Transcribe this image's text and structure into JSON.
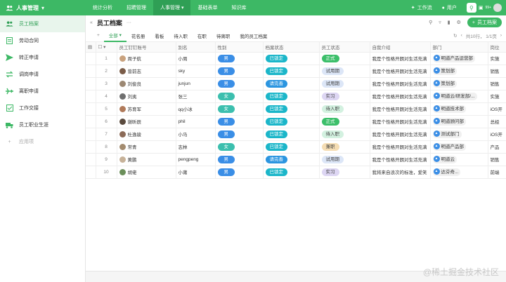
{
  "topbar": {
    "app_title": "人事管理",
    "nav": [
      "统计分析",
      "招聘管理",
      "人事管理",
      "基础表单",
      "知识库"
    ],
    "workflow": "工作流",
    "users": "用户",
    "badge": "99+"
  },
  "sidebar": {
    "items": [
      "员工档案",
      "劳动合同",
      "转正申请",
      "调岗申请",
      "离职申请",
      "工作交接",
      "员工职业生涯"
    ],
    "add_label": "应用项"
  },
  "header": {
    "title": "员工档案",
    "add_button": "员工档案"
  },
  "tabs": [
    "全部",
    "花名册",
    "看板",
    "待入职",
    "在职",
    "待离职",
    "我的员工档案"
  ],
  "pagination": "共10行， 1/1页",
  "table": {
    "columns": [
      "",
      "",
      "员工钉钉账号",
      "别名",
      "性别",
      "档案状态",
      "员工状态",
      "自我介绍",
      "部门",
      "岗位"
    ],
    "rows": [
      {
        "n": "1",
        "name": "周子航",
        "alias": "小周",
        "gender": "男",
        "gclass": "g-m",
        "arch": "已锁定",
        "aclass": "s1",
        "emp": "正式",
        "eclass": "e-zs",
        "intro": "我是个性格开朗对生活充满",
        "dept": "明道产品运营部",
        "pos": "实施"
      },
      {
        "n": "2",
        "name": "曾前志",
        "alias": "sky",
        "gender": "男",
        "gclass": "g-m",
        "arch": "已锁定",
        "aclass": "s1",
        "emp": "试用期",
        "eclass": "e-sy",
        "intro": "我是个性格开朗对生活充满",
        "dept": "策划部",
        "pos": "销售"
      },
      {
        "n": "3",
        "name": "刘俊良",
        "alias": "junjun",
        "gender": "男",
        "gclass": "g-m",
        "arch": "请完善",
        "aclass": "s2",
        "emp": "试用期",
        "eclass": "e-sy",
        "intro": "我是个性格开朗对生活充满",
        "dept": "策划部",
        "pos": "销售"
      },
      {
        "n": "4",
        "name": "刘夷",
        "alias": "张三",
        "gender": "女",
        "gclass": "g-f",
        "arch": "已锁定",
        "aclass": "s1",
        "emp": "实习",
        "eclass": "e-sx",
        "intro": "我是个性格开朗对生活充满",
        "dept": "明道云/研发部/...",
        "pos": "实施"
      },
      {
        "n": "5",
        "name": "苏育军",
        "alias": "qq小冰",
        "gender": "女",
        "gclass": "g-f",
        "arch": "已锁定",
        "aclass": "s1",
        "emp": "待入职",
        "eclass": "e-dr",
        "intro": "我是个性格开朗对生活充满",
        "dept": "明道技术部",
        "pos": "iOS开"
      },
      {
        "n": "6",
        "name": "谢昕辰",
        "alias": "phil",
        "gender": "男",
        "gclass": "g-m",
        "arch": "已锁定",
        "aclass": "s1",
        "emp": "正式",
        "eclass": "e-zs",
        "intro": "我是个性格开朗对生活充满",
        "dept": "明道顾问部",
        "pos": "总经"
      },
      {
        "n": "7",
        "name": "杜逸骏",
        "alias": "小马",
        "gender": "男",
        "gclass": "g-m",
        "arch": "已锁定",
        "aclass": "s1",
        "emp": "待入职",
        "eclass": "e-dr",
        "intro": "我是个性格开朗对生活充满",
        "dept": "测试部门",
        "pos": "iOS开"
      },
      {
        "n": "8",
        "name": "常青",
        "alias": "志林",
        "gender": "女",
        "gclass": "g-f",
        "arch": "已锁定",
        "aclass": "s1",
        "emp": "兼职",
        "eclass": "e-jz",
        "intro": "我是个性格开朗对生活充满",
        "dept": "明道产品部",
        "pos": "产品"
      },
      {
        "n": "9",
        "name": "黄鹏",
        "alias": "pengpeng",
        "gender": "男",
        "gclass": "g-m",
        "arch": "请完善",
        "aclass": "s2",
        "emp": "试用期",
        "eclass": "e-sy",
        "intro": "我是个性格开朗对生活充满",
        "dept": "明道云",
        "pos": "销售"
      },
      {
        "n": "10",
        "name": "胡佬",
        "alias": "小莆",
        "gender": "男",
        "gclass": "g-m",
        "arch": "已锁定",
        "aclass": "s1",
        "emp": "实习",
        "eclass": "e-sx",
        "intro": "我将来自浪次的标准，爱笑",
        "dept": "达芬奇...",
        "pos": "前端"
      }
    ]
  },
  "watermark": "@稀土掘金技术社区",
  "colors": {
    "brand": "#3db865",
    "nav_active": "#2f9f55"
  }
}
